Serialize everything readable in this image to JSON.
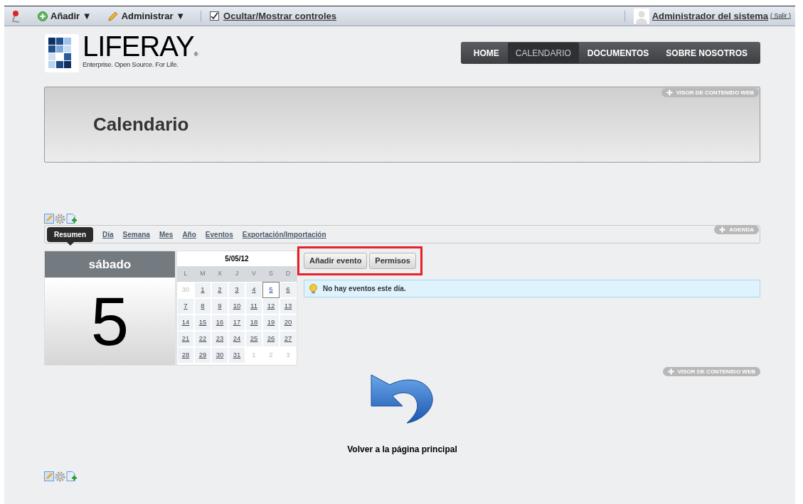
{
  "dockbar": {
    "items": [
      {
        "kind": "add",
        "label": "Añadir",
        "caret": "▼"
      },
      {
        "kind": "manage",
        "label": "Administrar",
        "caret": "▼"
      }
    ],
    "toggle": {
      "label": "Ocultar/Mostrar controles",
      "checked": true
    },
    "user": {
      "name": "Administrador del sistema",
      "logout": "( Salir )"
    }
  },
  "logo": {
    "name": "LIFERAY",
    "mark": "®",
    "tagline": "Enterprise. Open Source. For Life."
  },
  "nav": [
    {
      "label": "HOME",
      "selected": false
    },
    {
      "label": "CALENDARIO",
      "selected": true
    },
    {
      "label": "DOCUMENTOS",
      "selected": false
    },
    {
      "label": "SOBRE NOSOTROS",
      "selected": false
    }
  ],
  "header_portlet": {
    "badge": "VISOR DE CONTENIDO WEB",
    "title": "Calendario"
  },
  "calendar_portlet": {
    "badge": "AGENDA",
    "tabs": [
      {
        "label": "Resumen",
        "selected": true
      },
      {
        "label": "Día",
        "selected": false
      },
      {
        "label": "Semana",
        "selected": false
      },
      {
        "label": "Mes",
        "selected": false
      },
      {
        "label": "Año",
        "selected": false
      },
      {
        "label": "Eventos",
        "selected": false
      },
      {
        "label": "Exportación/Importación",
        "selected": false
      }
    ],
    "day_name": "sábado",
    "day_number": "5",
    "month_title": "5/05/12",
    "weekdays": [
      "L",
      "M",
      "X",
      "J",
      "V",
      "S",
      "D"
    ],
    "weeks": [
      [
        {
          "day": "30",
          "in_month": false,
          "selected": false
        },
        {
          "day": "1",
          "in_month": true,
          "selected": false
        },
        {
          "day": "2",
          "in_month": true,
          "selected": false
        },
        {
          "day": "3",
          "in_month": true,
          "selected": false
        },
        {
          "day": "4",
          "in_month": true,
          "selected": false
        },
        {
          "day": "5",
          "in_month": true,
          "selected": true
        },
        {
          "day": "6",
          "in_month": true,
          "selected": false
        }
      ],
      [
        {
          "day": "7",
          "in_month": true,
          "selected": false
        },
        {
          "day": "8",
          "in_month": true,
          "selected": false
        },
        {
          "day": "9",
          "in_month": true,
          "selected": false
        },
        {
          "day": "10",
          "in_month": true,
          "selected": false
        },
        {
          "day": "11",
          "in_month": true,
          "selected": false
        },
        {
          "day": "12",
          "in_month": true,
          "selected": false
        },
        {
          "day": "13",
          "in_month": true,
          "selected": false
        }
      ],
      [
        {
          "day": "14",
          "in_month": true,
          "selected": false
        },
        {
          "day": "15",
          "in_month": true,
          "selected": false
        },
        {
          "day": "16",
          "in_month": true,
          "selected": false
        },
        {
          "day": "17",
          "in_month": true,
          "selected": false
        },
        {
          "day": "18",
          "in_month": true,
          "selected": false
        },
        {
          "day": "19",
          "in_month": true,
          "selected": false
        },
        {
          "day": "20",
          "in_month": true,
          "selected": false
        }
      ],
      [
        {
          "day": "21",
          "in_month": true,
          "selected": false
        },
        {
          "day": "22",
          "in_month": true,
          "selected": false
        },
        {
          "day": "23",
          "in_month": true,
          "selected": false
        },
        {
          "day": "24",
          "in_month": true,
          "selected": false
        },
        {
          "day": "25",
          "in_month": true,
          "selected": false
        },
        {
          "day": "26",
          "in_month": true,
          "selected": false
        },
        {
          "day": "27",
          "in_month": true,
          "selected": false
        }
      ],
      [
        {
          "day": "28",
          "in_month": true,
          "selected": false
        },
        {
          "day": "29",
          "in_month": true,
          "selected": false
        },
        {
          "day": "30",
          "in_month": true,
          "selected": false
        },
        {
          "day": "31",
          "in_month": true,
          "selected": false
        },
        {
          "day": "1",
          "in_month": false,
          "selected": false
        },
        {
          "day": "2",
          "in_month": false,
          "selected": false
        },
        {
          "day": "3",
          "in_month": false,
          "selected": false
        }
      ]
    ],
    "buttons": [
      "Añadir evento",
      "Permisos"
    ],
    "message": "No hay eventos este día."
  },
  "link_portlet": {
    "badge": "VISOR DE CONTENIDO WEB",
    "link": "Volver a la página principal"
  }
}
